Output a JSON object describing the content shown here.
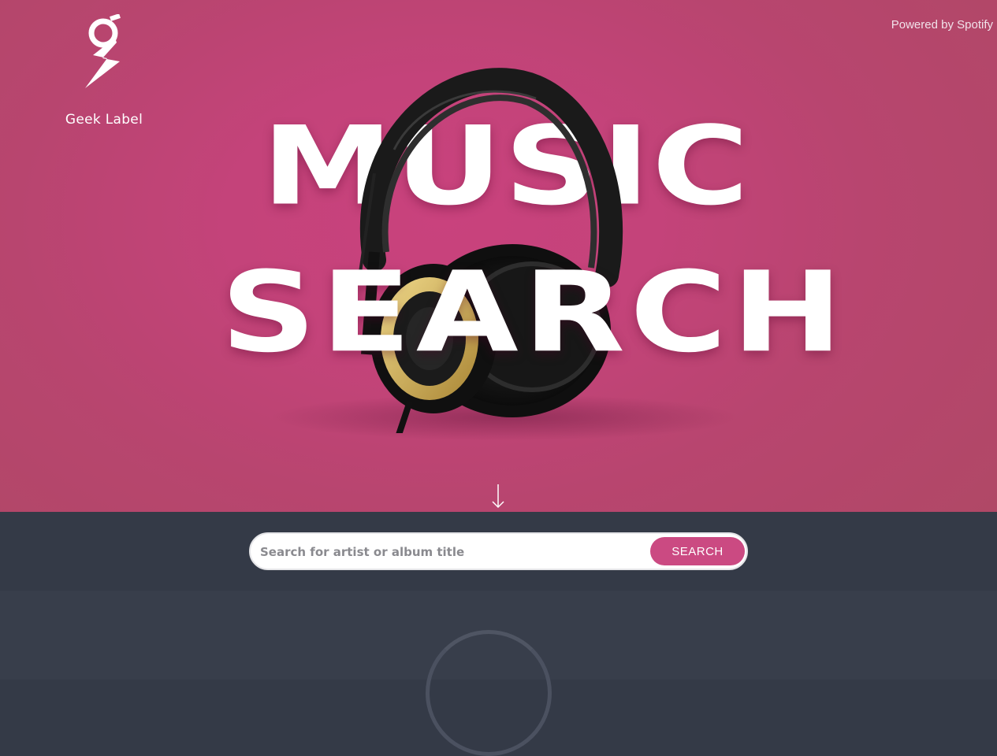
{
  "brand": {
    "name": "Geek Label",
    "logo_icon": "g-lightning-icon"
  },
  "header": {
    "powered_by": "Powered by Spotify"
  },
  "hero": {
    "line1": "MUSIC",
    "line2": "SEARCH",
    "image": "headphones-image",
    "scroll_icon": "arrow-down-icon"
  },
  "search": {
    "placeholder": "Search for artist or album title",
    "value": "",
    "button_label": "SEARCH"
  },
  "results": {
    "loading_icon": "spinner-icon"
  },
  "colors": {
    "hero_pink": "#c4437a",
    "accent": "#cb4a82",
    "dark": "#343a47"
  }
}
